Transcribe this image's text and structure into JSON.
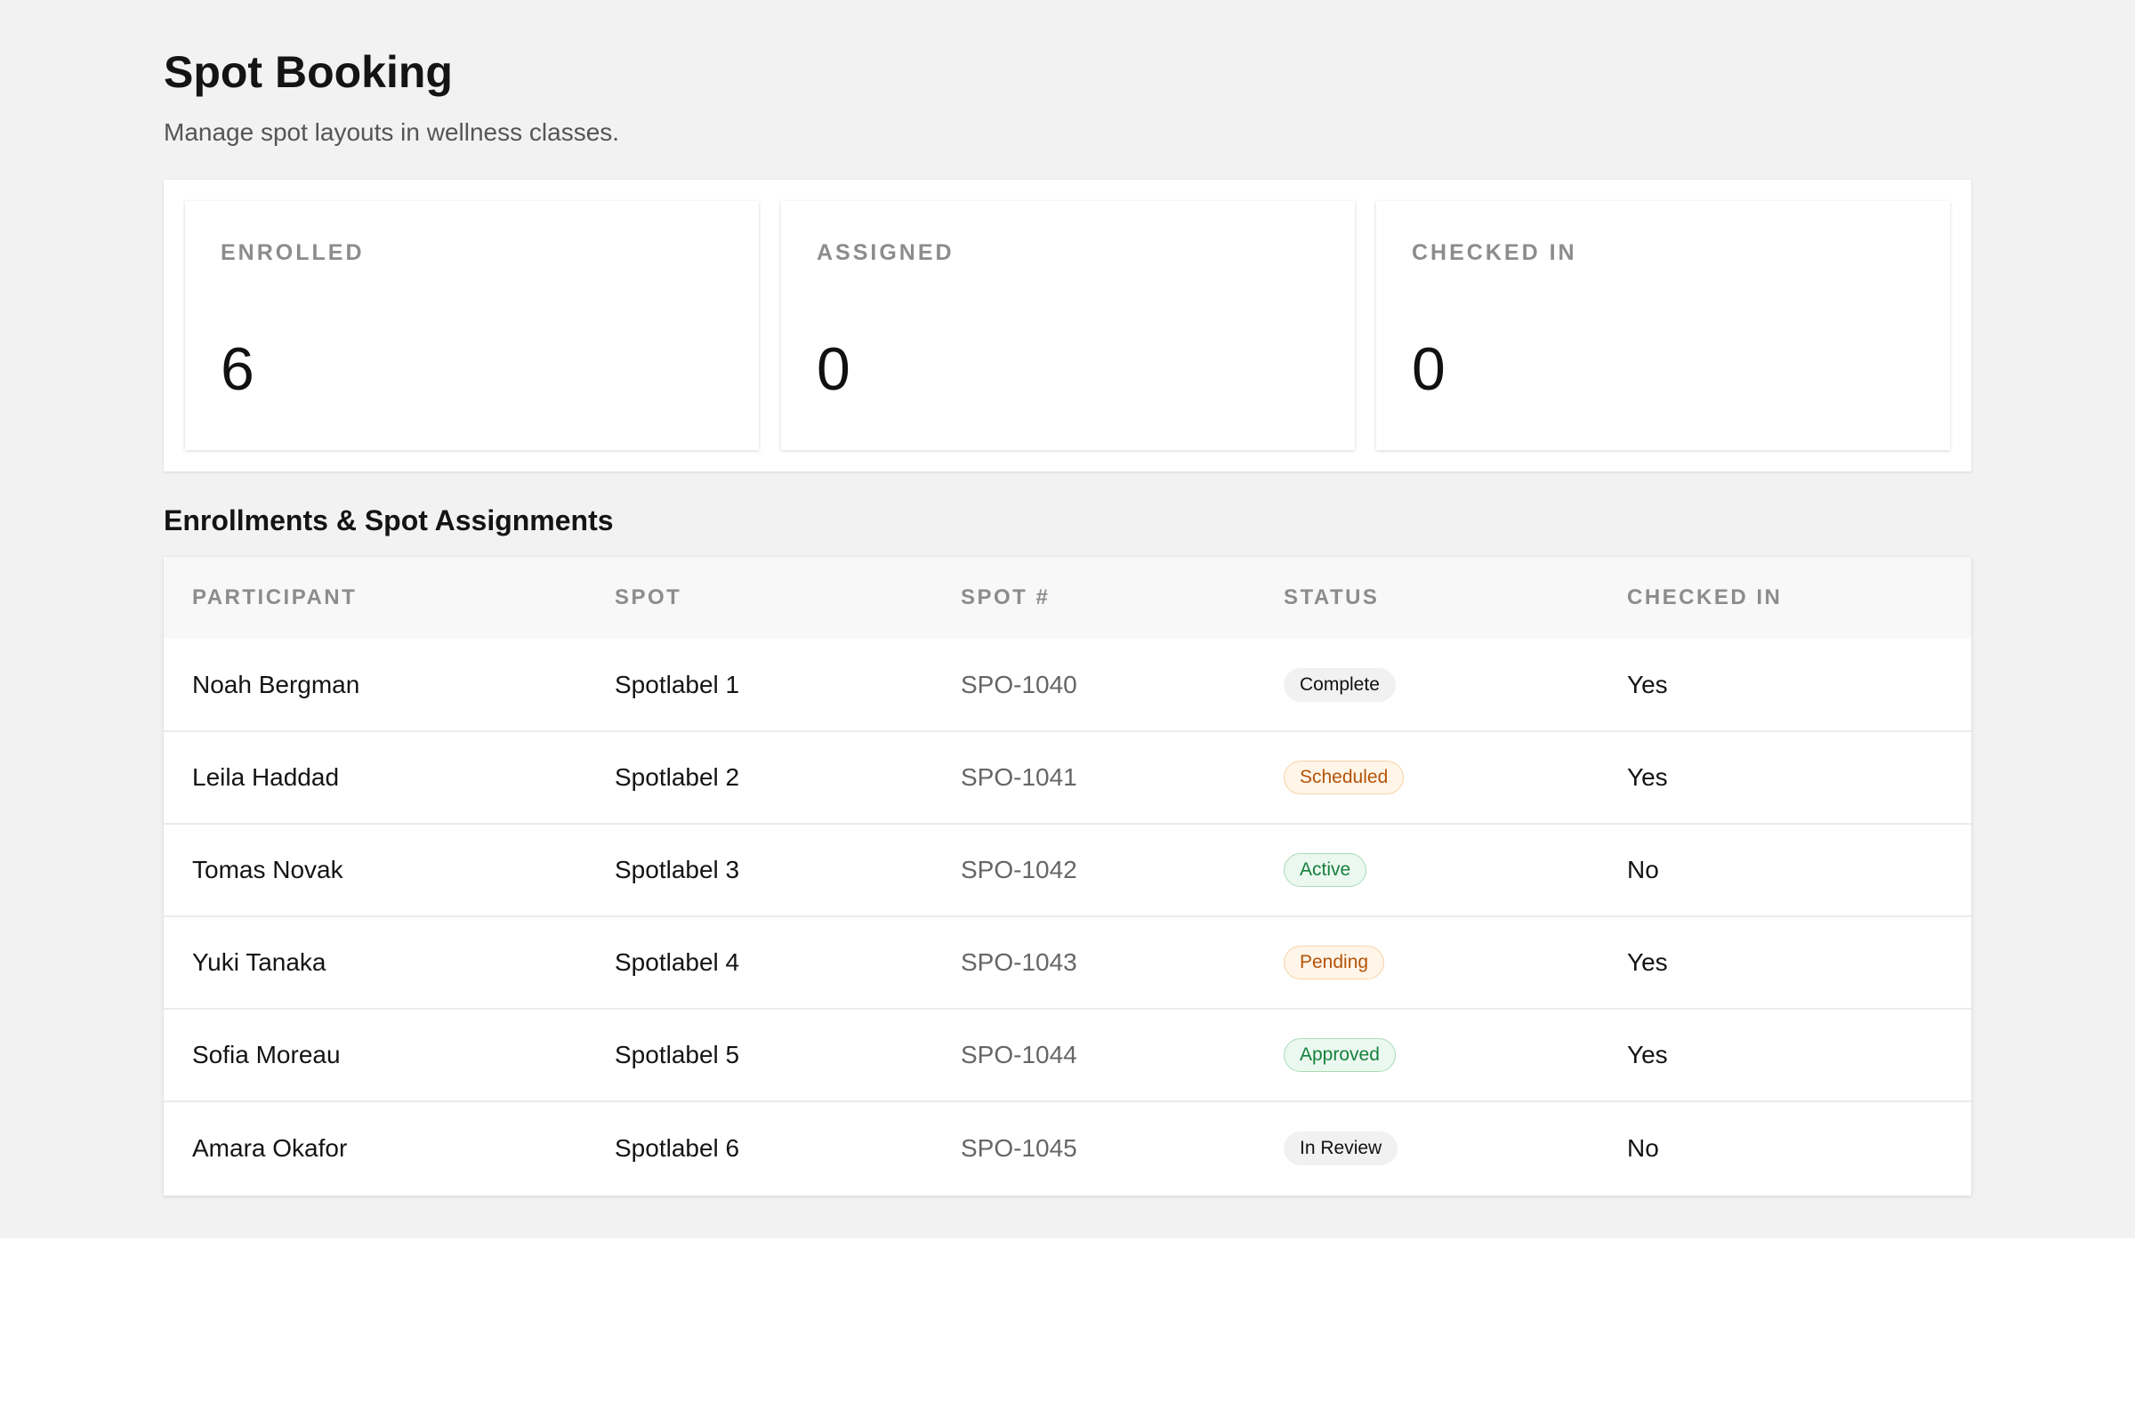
{
  "header": {
    "title": "Spot Booking",
    "subtitle": "Manage spot layouts in wellness classes."
  },
  "stats": [
    {
      "label": "ENROLLED",
      "value": "6"
    },
    {
      "label": "ASSIGNED",
      "value": "0"
    },
    {
      "label": "CHECKED IN",
      "value": "0"
    }
  ],
  "table": {
    "title": "Enrollments & Spot Assignments",
    "columns": [
      "PARTICIPANT",
      "SPOT",
      "SPOT #",
      "STATUS",
      "CHECKED IN"
    ],
    "rows": [
      {
        "participant": "Noah Bergman",
        "spot": "Spotlabel 1",
        "spot_number": "SPO-1040",
        "status": "Complete",
        "status_tone": "neutral",
        "checked_in": "Yes"
      },
      {
        "participant": "Leila Haddad",
        "spot": "Spotlabel 2",
        "spot_number": "SPO-1041",
        "status": "Scheduled",
        "status_tone": "orange",
        "checked_in": "Yes"
      },
      {
        "participant": "Tomas Novak",
        "spot": "Spotlabel 3",
        "spot_number": "SPO-1042",
        "status": "Active",
        "status_tone": "green",
        "checked_in": "No"
      },
      {
        "participant": "Yuki Tanaka",
        "spot": "Spotlabel 4",
        "spot_number": "SPO-1043",
        "status": "Pending",
        "status_tone": "orange",
        "checked_in": "Yes"
      },
      {
        "participant": "Sofia Moreau",
        "spot": "Spotlabel 5",
        "spot_number": "SPO-1044",
        "status": "Approved",
        "status_tone": "green",
        "checked_in": "Yes"
      },
      {
        "participant": "Amara Okafor",
        "spot": "Spotlabel 6",
        "spot_number": "SPO-1045",
        "status": "In Review",
        "status_tone": "neutral",
        "checked_in": "No"
      }
    ]
  },
  "colors": {
    "page_background": "#f2f2f2",
    "panel_background": "#ffffff",
    "muted_text": "#8c8c8c",
    "badge_orange_text": "#b45309",
    "badge_green_text": "#15803d"
  }
}
